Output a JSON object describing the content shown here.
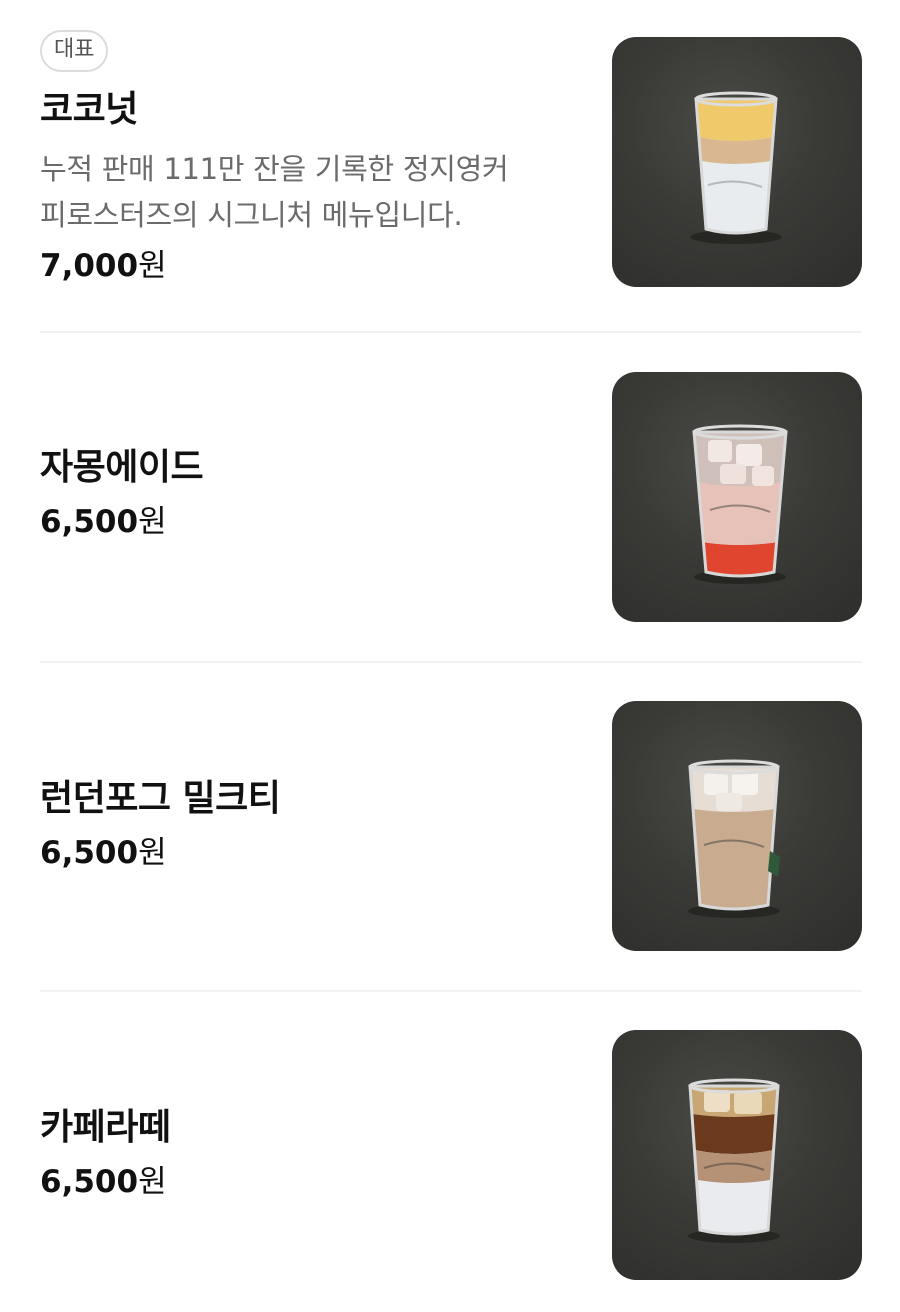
{
  "menu": {
    "items": [
      {
        "badge": "대표",
        "name": "코코넛",
        "description": "누적 판매 111만 잔을 기록한 정지영커피로스터즈의 시그니처 메뉴입니다.",
        "description_lines": [
          "누적 판매 111만 잔을 기록한 정지영커",
          "피로스터즈의 시그니처 메뉴입니다."
        ],
        "price": "7,000",
        "currency": "원",
        "image_icon": "coconut-drink-image"
      },
      {
        "name": "자몽에이드",
        "price": "6,500",
        "currency": "원",
        "image_icon": "grapefruit-ade-image"
      },
      {
        "name": "런던포그 밀크티",
        "price": "6,500",
        "currency": "원",
        "image_icon": "london-fog-milk-tea-image"
      },
      {
        "name": "카페라떼",
        "price": "6,500",
        "currency": "원",
        "image_icon": "cafe-latte-image"
      }
    ]
  },
  "colors": {
    "text_primary": "#111111",
    "text_secondary": "#6b6b6b",
    "badge_border": "#dcdcdc",
    "divider": "#f2f2f2",
    "photo_background": "#3a3a37"
  }
}
